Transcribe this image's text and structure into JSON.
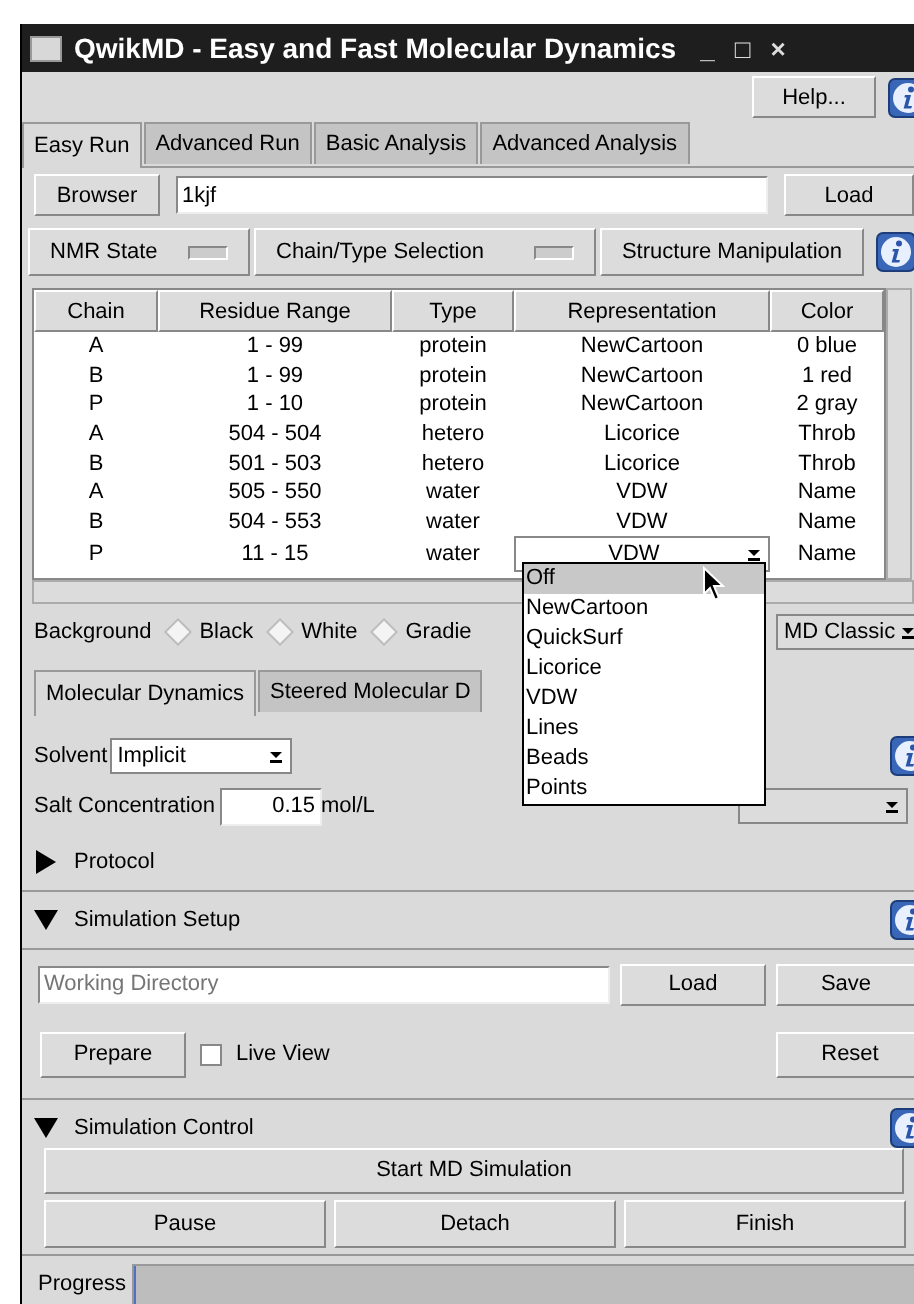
{
  "window": {
    "title": "QwikMD - Easy and Fast Molecular Dynamics",
    "controls": [
      "_",
      "□",
      "×"
    ]
  },
  "help_button": "Help...",
  "main_tabs": [
    {
      "label": "Easy Run",
      "selected": true
    },
    {
      "label": "Advanced Run",
      "selected": false
    },
    {
      "label": "Basic Analysis",
      "selected": false
    },
    {
      "label": "Advanced Analysis",
      "selected": false
    }
  ],
  "browser": {
    "button": "Browser",
    "value": "1kjf",
    "load": "Load"
  },
  "section_toggles": [
    {
      "label": "NMR State",
      "kind": "toggle"
    },
    {
      "label": "Chain/Type Selection",
      "kind": "toggle"
    },
    {
      "label": "Structure Manipulation",
      "kind": "button"
    }
  ],
  "table": {
    "columns": [
      "Chain",
      "Residue Range",
      "Type",
      "Representation",
      "Color"
    ],
    "rows": [
      {
        "cells": [
          "A",
          "1 - 99",
          "protein",
          "NewCartoon",
          "0 blue"
        ],
        "editing": false
      },
      {
        "cells": [
          "B",
          "1 - 99",
          "protein",
          "NewCartoon",
          "1 red"
        ],
        "editing": false
      },
      {
        "cells": [
          "P",
          "1 - 10",
          "protein",
          "NewCartoon",
          "2 gray"
        ],
        "editing": false
      },
      {
        "cells": [
          "A",
          "504 - 504",
          "hetero",
          "Licorice",
          "Throb"
        ],
        "editing": false
      },
      {
        "cells": [
          "B",
          "501 - 503",
          "hetero",
          "Licorice",
          "Throb"
        ],
        "editing": false
      },
      {
        "cells": [
          "A",
          "505 - 550",
          "water",
          "VDW",
          "Name"
        ],
        "editing": false
      },
      {
        "cells": [
          "B",
          "504 - 553",
          "water",
          "VDW",
          "Name"
        ],
        "editing": false
      },
      {
        "cells": [
          "P",
          "11 - 15",
          "water",
          "VDW",
          "Name"
        ],
        "editing": true
      }
    ]
  },
  "representation_menu": [
    {
      "label": "Off",
      "selected": true
    },
    {
      "label": "NewCartoon",
      "selected": false
    },
    {
      "label": "QuickSurf",
      "selected": false
    },
    {
      "label": "Licorice",
      "selected": false
    },
    {
      "label": "VDW",
      "selected": false
    },
    {
      "label": "Lines",
      "selected": false
    },
    {
      "label": "Beads",
      "selected": false
    },
    {
      "label": "Points",
      "selected": false
    }
  ],
  "background": {
    "label": "Background",
    "options": [
      {
        "label": "Black",
        "selected": false
      },
      {
        "label": "White",
        "selected": false
      },
      {
        "label": "Gradie",
        "selected": false
      }
    ],
    "style": "MD Classic"
  },
  "protocol_tabs": [
    {
      "label": "Molecular Dynamics",
      "selected": true
    },
    {
      "label": "Steered Molecular D",
      "selected": false
    }
  ],
  "solvent": {
    "label": "Solvent",
    "value": "Implicit"
  },
  "salt": {
    "label": "Salt Concentration",
    "value": "0.15",
    "unit": "mol/L"
  },
  "protocol": {
    "label": "Protocol",
    "expanded": false
  },
  "setup": {
    "label": "Simulation Setup",
    "expanded": true,
    "placeholder": "Working Directory",
    "load": "Load",
    "save": "Save",
    "prepare": "Prepare",
    "live_view": {
      "label": "Live View",
      "checked": false
    },
    "reset": "Reset"
  },
  "control": {
    "label": "Simulation Control",
    "expanded": true,
    "start": "Start MD Simulation",
    "buttons": [
      "Pause",
      "Detach",
      "Finish"
    ],
    "progress_label": "Progress",
    "level": 0
  }
}
